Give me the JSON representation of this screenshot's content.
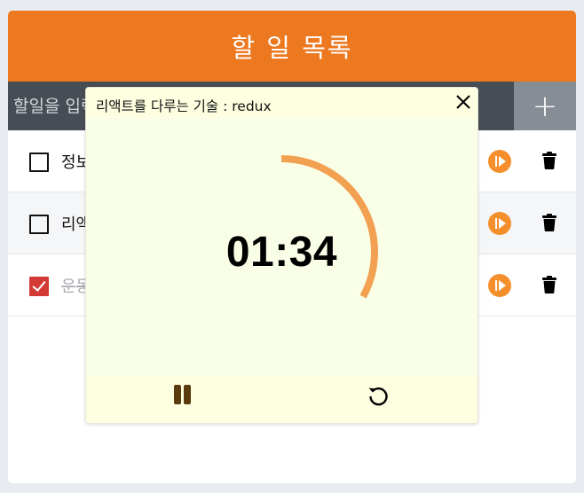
{
  "app": {
    "title": "할 일 목록"
  },
  "input": {
    "placeholder": "할일을 입력하세요",
    "add_label": "+"
  },
  "todos": [
    {
      "text": "정보",
      "done": false
    },
    {
      "text": "리액",
      "done": false
    },
    {
      "text": "운동",
      "done": true
    }
  ],
  "timer": {
    "task": "리액트를 다루는 기술 : redux",
    "time": "01:34",
    "progress": 0.33
  },
  "colors": {
    "header": "#ec7820",
    "input_bar": "#474d55",
    "add_button": "#878d95",
    "play": "#f58f2c",
    "checked": "#d43a35",
    "progress_arc": "#f2a052",
    "popup_bg": "#f9ffe6",
    "pause": "#5b3a0e"
  },
  "icons": {
    "play": "play-circle-icon",
    "trash": "trash-icon",
    "close": "close-icon",
    "pause": "pause-icon",
    "reset": "reset-icon",
    "checkbox": "checkbox-icon"
  }
}
